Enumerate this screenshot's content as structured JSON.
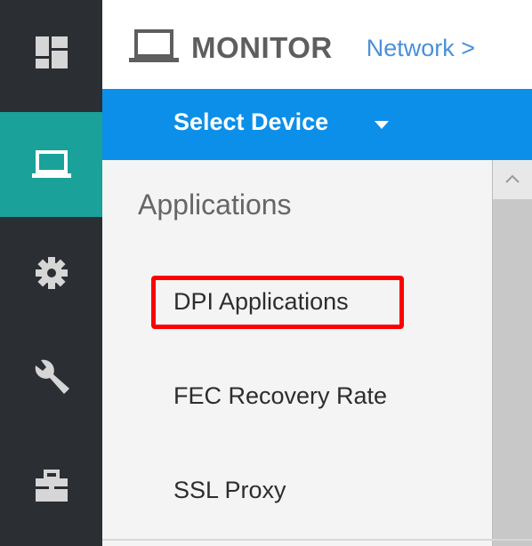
{
  "header": {
    "title": "MONITOR",
    "breadcrumb": "Network >",
    "icon": "monitor-icon"
  },
  "rail": {
    "items": [
      {
        "icon": "dashboard-icon",
        "active": false
      },
      {
        "icon": "monitor-icon",
        "active": true
      },
      {
        "icon": "gear-icon",
        "active": false
      },
      {
        "icon": "wrench-icon",
        "active": false
      },
      {
        "icon": "toolbox-icon",
        "active": false
      }
    ]
  },
  "device_bar": {
    "label": "Select Device",
    "icon": "caret-down-icon"
  },
  "panel": {
    "section_title": "Applications",
    "items": [
      {
        "label": "DPI Applications",
        "highlighted": true
      },
      {
        "label": "FEC Recovery Rate",
        "highlighted": false
      },
      {
        "label": "SSL Proxy",
        "highlighted": false
      }
    ]
  },
  "colors": {
    "rail_bg": "#2b2e33",
    "rail_active": "#1aa19a",
    "device_bar": "#0c8fe8",
    "breadcrumb": "#4a90d9",
    "highlight": "#ff0000"
  }
}
